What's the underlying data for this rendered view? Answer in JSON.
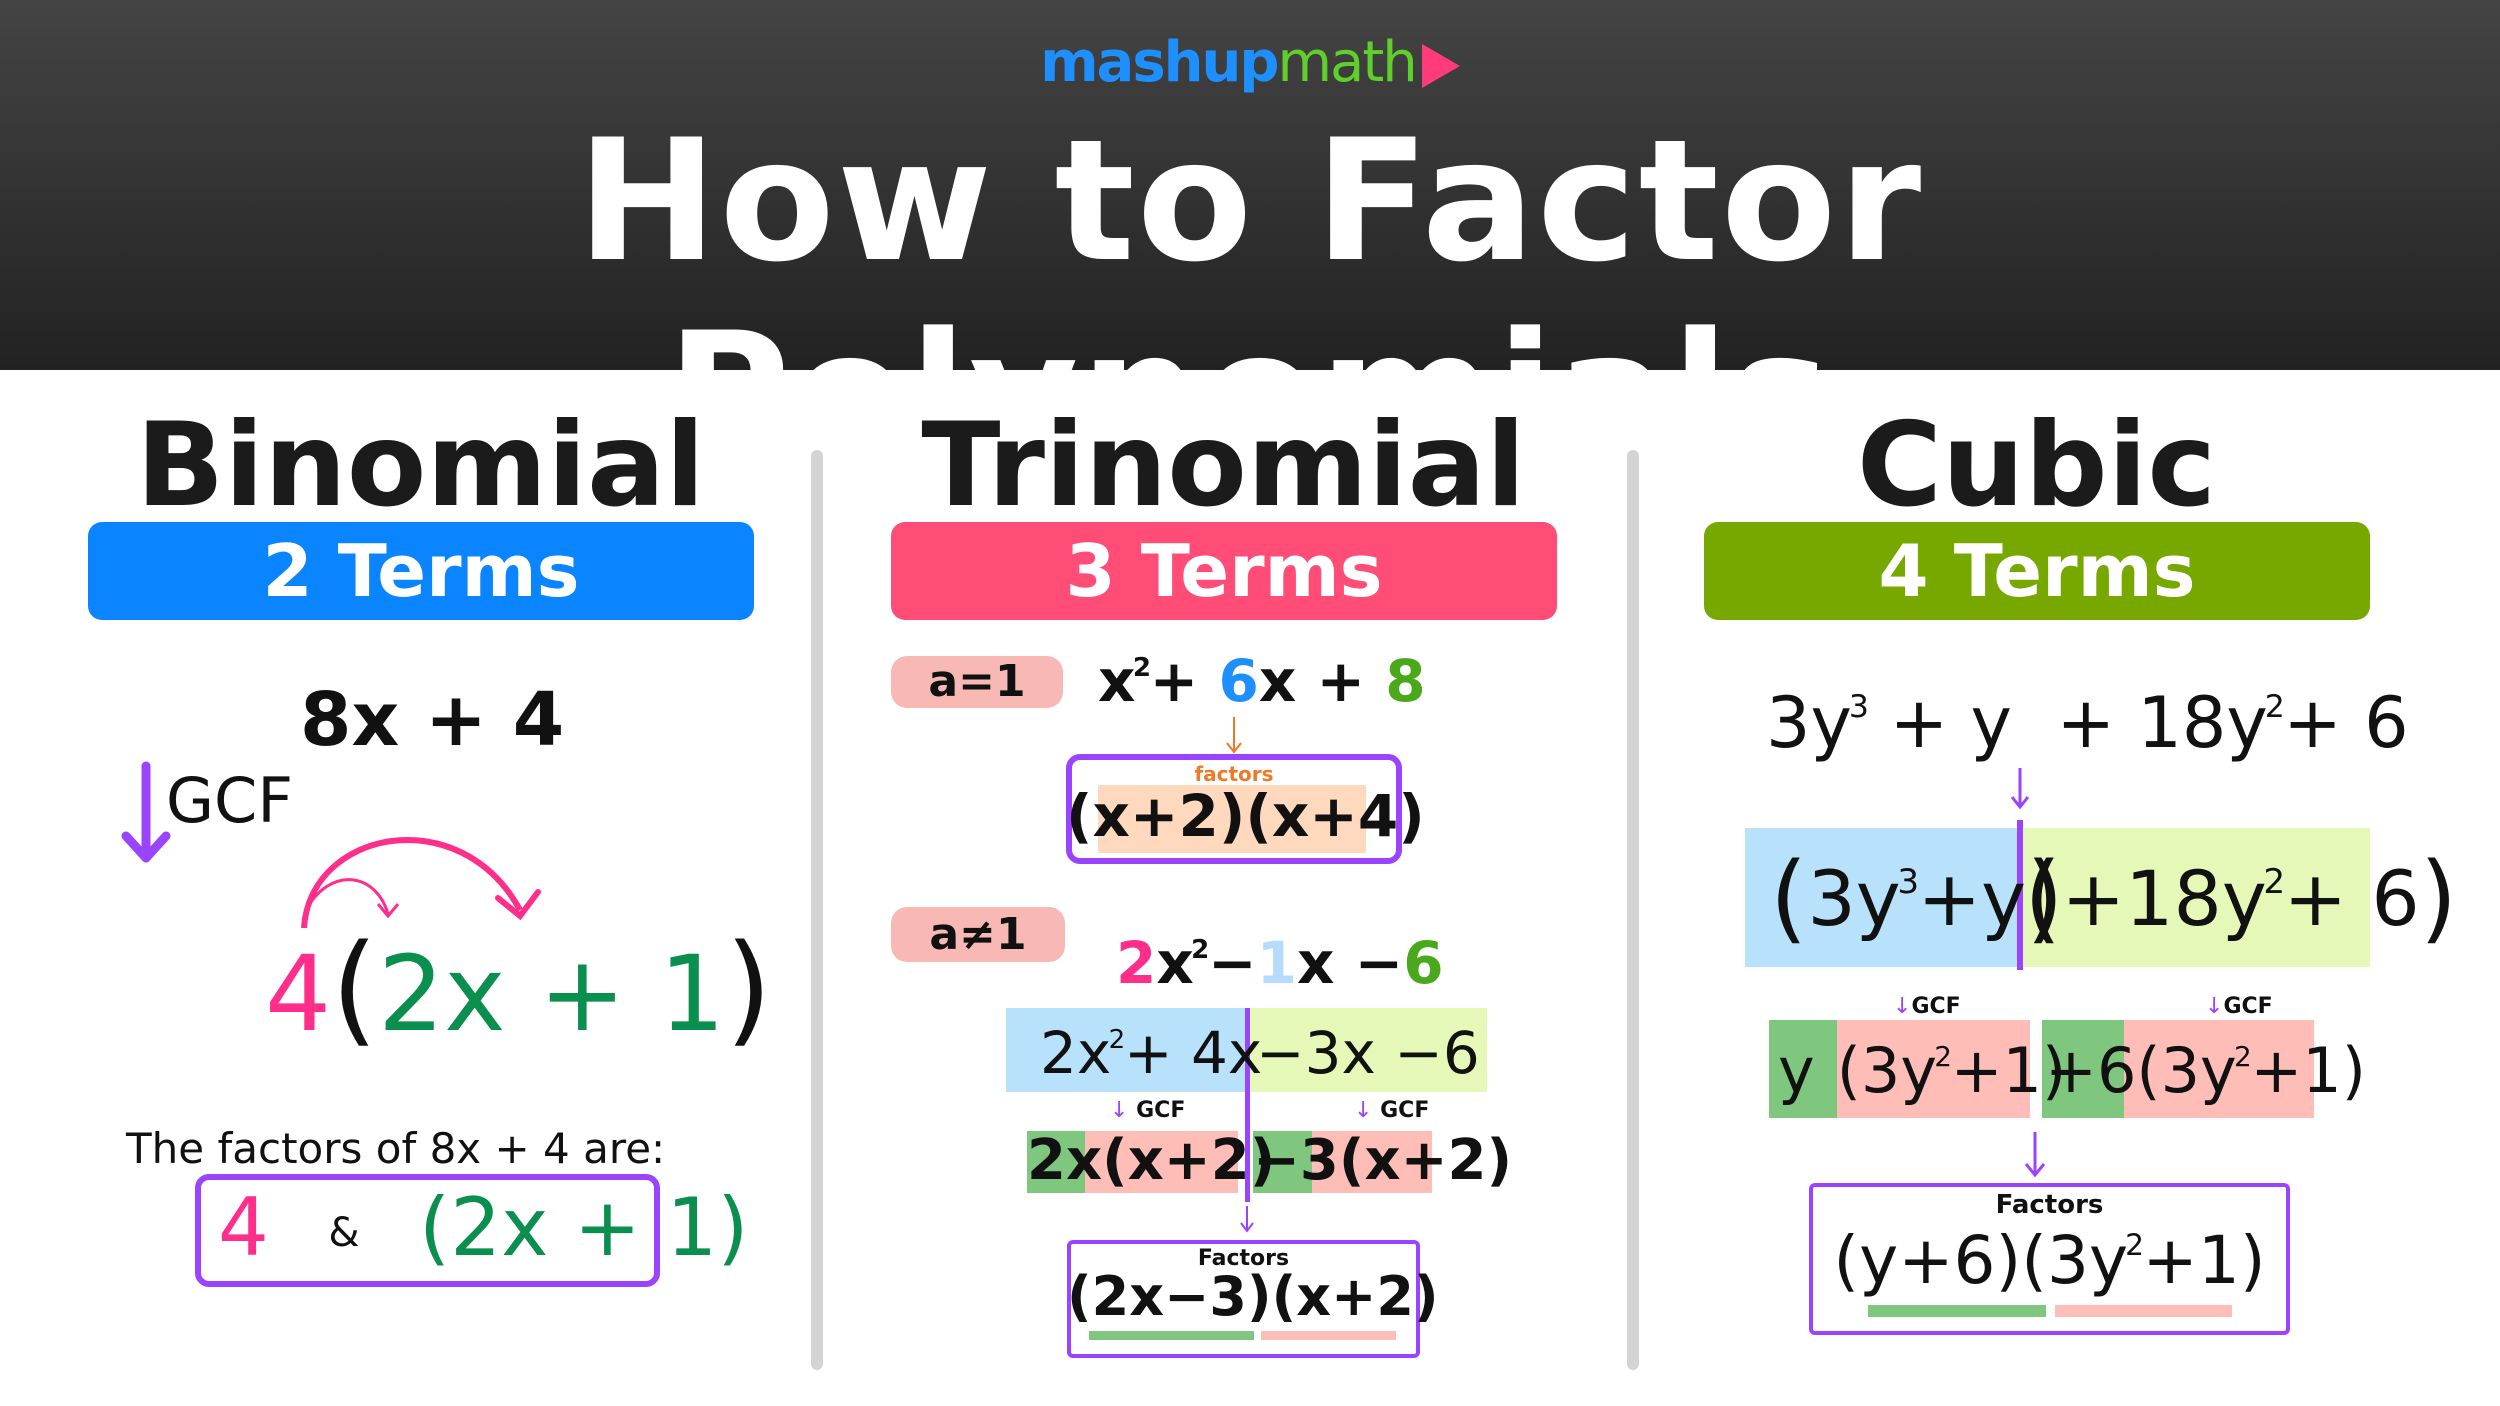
{
  "header": {
    "logo": {
      "part1": "mashup",
      "part2": "math",
      "icon": "play-triangle-icon"
    },
    "title": "How to Factor Polynomials"
  },
  "colors": {
    "binomial_accent": "#0a84ff",
    "trinomial_accent": "#ff4d78",
    "cubic_accent": "#77a800",
    "purple": "#9a44ff",
    "pink": "#ff2e8b",
    "green": "#0b8f4e"
  },
  "binomial": {
    "title": "Binomial",
    "terms_label": "2 Terms",
    "expression": "8x + 4",
    "gcf_label": "GCF",
    "factored": {
      "gcf": "4",
      "open": "(",
      "inner": "2x + 1",
      "close": ")"
    },
    "conclusion": "The factors of 8x + 4 are:",
    "answer": {
      "first": "4",
      "amp": "&",
      "second": "(2x + 1)"
    }
  },
  "trinomial": {
    "title": "Trinomial",
    "terms_label": "3 Terms",
    "case1": {
      "label": "a=1",
      "expr": {
        "x": "x",
        "exp": "2",
        "plus1": "+",
        "b": "6",
        "xb": "x +",
        "c": "8"
      },
      "factors_label": "factors",
      "factors": "(x+2)(x+4)"
    },
    "case2": {
      "label": "a≠1",
      "expr": {
        "a": "2",
        "x": "x",
        "exp": "2",
        "minus": "−",
        "b": "1",
        "xb": "x −",
        "c": "6"
      },
      "split_left": {
        "base": "2x",
        "exp": "2",
        "rest": "+ 4x"
      },
      "split_right": "−3x −6",
      "gcf_label": "GCF",
      "group_left": {
        "gcf": "2x",
        "binomial": "(x+2)"
      },
      "group_right": {
        "gcf": "−3",
        "binomial": "(x+2)"
      },
      "factors_label": "Factors",
      "factors": "(2x−3)(x+2)"
    }
  },
  "cubic": {
    "title": "Cubic",
    "terms_label": "4 Terms",
    "expression": {
      "t1": "3y",
      "e1": "3",
      "t2": "+ y",
      "t3": "+ 18y",
      "e3": "2",
      "t4": "+ 6"
    },
    "split_left": {
      "open": "(",
      "base": "3y",
      "exp": "3",
      "rest": "+y",
      "close": ")"
    },
    "split_right": {
      "open": "(",
      "base": "+18y",
      "exp": "2",
      "rest": "+ 6",
      "close": ")"
    },
    "gcf_label": "GCF",
    "group_left": {
      "gcf": "y",
      "binomial_pre": "(3y",
      "exp": "2",
      "binomial_post": "+1)"
    },
    "group_right": {
      "gcf": "+6",
      "binomial_pre": "(3y",
      "exp": "2",
      "binomial_post": "+1)"
    },
    "factors_label": "Factors",
    "factors": {
      "first": "(y+6)",
      "second_pre": "(3y",
      "exp": "2",
      "second_post": "+1)"
    }
  }
}
